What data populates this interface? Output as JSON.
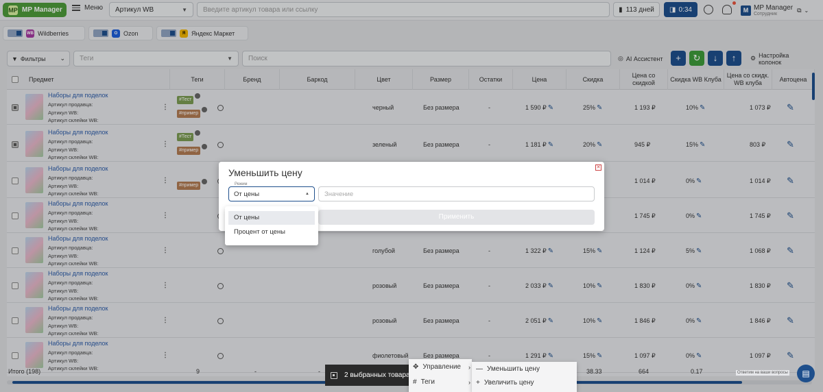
{
  "header": {
    "logo": "MP Manager",
    "logo_mark": "MP",
    "menu": "Меню",
    "article_select": "Артикул WB",
    "search_placeholder": "Введите артикул товара или ссылку",
    "days": "113 дней",
    "timer": "0:34",
    "user_name": "MP Manager",
    "user_role": "Сотрудник",
    "user_initial": "M"
  },
  "marketplaces": [
    {
      "label": "Wildberries",
      "mark": "WB",
      "color": "#a43aa0"
    },
    {
      "label": "Ozon",
      "mark": "O",
      "color": "#1e5fd8"
    },
    {
      "label": "Яндекс Маркет",
      "mark": "Я",
      "color": "#f0b400"
    }
  ],
  "toolbar": {
    "filters": "Фильтры",
    "tags_placeholder": "Теги",
    "search_placeholder": "Поиск",
    "ai": "AI Ассистент",
    "columns": "Настройка колонок"
  },
  "columns": [
    "Предмет",
    "Теги",
    "Бренд",
    "Баркод",
    "Цвет",
    "Размер",
    "Остатки",
    "Цена",
    "Скидка",
    "Цена со скидкой",
    "Скидка WB Клуба",
    "Цена со скидк. WB клуба",
    "Автоцена"
  ],
  "rows": [
    {
      "title": "Наборы для поделок",
      "sub": [
        "Артикул продавца:",
        "Артикул WB:",
        "Артикул склейки WB:"
      ],
      "tags": [
        "#Тест",
        "#пример"
      ],
      "color": "черный",
      "size": "Без размера",
      "stock": "-",
      "price": "1 590 ₽",
      "discount": "25%",
      "sale_price": "1 193 ₽",
      "club": "10%",
      "club_price": "1 073 ₽",
      "checked": true
    },
    {
      "title": "Наборы для поделок",
      "sub": [
        "Артикул продавца:",
        "Артикул WB:",
        "Артикул склейки WB:"
      ],
      "tags": [
        "#Тест",
        "#пример"
      ],
      "color": "зеленый",
      "size": "Без размера",
      "stock": "-",
      "price": "1 181 ₽",
      "discount": "20%",
      "sale_price": "945 ₽",
      "club": "15%",
      "club_price": "803 ₽",
      "checked": true
    },
    {
      "title": "Наборы для поделок",
      "sub": [
        "Артикул продавца:",
        "Артикул WB:",
        "Артикул склейки WB:"
      ],
      "tags": [
        "#пример"
      ],
      "color": "",
      "size": "",
      "stock": "",
      "price": "",
      "discount": "",
      "sale_price": "1 014 ₽",
      "club": "0%",
      "club_price": "1 014 ₽",
      "checked": false
    },
    {
      "title": "Наборы для поделок",
      "sub": [
        "Артикул продавца:",
        "Артикул WB:",
        "Артикул склейки WB:"
      ],
      "tags": [],
      "color": "",
      "size": "",
      "stock": "",
      "price": "",
      "discount": "",
      "sale_price": "1 745 ₽",
      "club": "0%",
      "club_price": "1 745 ₽",
      "checked": false
    },
    {
      "title": "Наборы для поделок",
      "sub": [
        "Артикул продавца:",
        "Артикул WB:",
        "Артикул склейки WB:"
      ],
      "tags": [],
      "color": "голубой",
      "size": "Без размера",
      "stock": "-",
      "price": "1 322 ₽",
      "discount": "15%",
      "sale_price": "1 124 ₽",
      "club": "5%",
      "club_price": "1 068 ₽",
      "checked": false
    },
    {
      "title": "Наборы для поделок",
      "sub": [
        "Артикул продавца:",
        "Артикул WB:",
        "Артикул склейки WB:"
      ],
      "tags": [],
      "color": "розовый",
      "size": "Без размера",
      "stock": "-",
      "price": "2 033 ₽",
      "discount": "10%",
      "sale_price": "1 830 ₽",
      "club": "0%",
      "club_price": "1 830 ₽",
      "checked": false
    },
    {
      "title": "Наборы для поделок",
      "sub": [
        "Артикул продавца:",
        "Артикул WB:",
        "Артикул склейки WB:"
      ],
      "tags": [],
      "color": "розовый",
      "size": "Без размера",
      "stock": "-",
      "price": "2 051 ₽",
      "discount": "10%",
      "sale_price": "1 846 ₽",
      "club": "0%",
      "club_price": "1 846 ₽",
      "checked": false
    },
    {
      "title": "Наборы для поделок",
      "sub": [
        "Артикул продавца:",
        "Артикул WB:",
        "Артикул склейки WB:"
      ],
      "tags": [],
      "color": "фиолетовый",
      "size": "Без размера",
      "stock": "-",
      "price": "1 291 ₽",
      "discount": "15%",
      "sale_price": "1 097 ₽",
      "club": "0%",
      "club_price": "1 097 ₽",
      "checked": false
    }
  ],
  "totals": {
    "label": "Итого (198)",
    "tags": "9",
    "brand": "-",
    "barcode": "-",
    "discount": "38.33",
    "sale_price": "664",
    "club": "0.17"
  },
  "modal": {
    "title": "Уменьшить цену",
    "mode_label": "Режим",
    "mode_value": "От цены",
    "value_placeholder": "Значение",
    "apply": "Применить",
    "options": [
      "От цены",
      "Процент от цены"
    ]
  },
  "bulk": {
    "selected": "2 выбранных товара"
  },
  "context": {
    "manage": "Управление",
    "tags": "Теги",
    "decrease": "Уменьшить цену",
    "increase": "Увеличить цену"
  },
  "chat": {
    "tooltip": "Ответим на ваши вопросы"
  }
}
